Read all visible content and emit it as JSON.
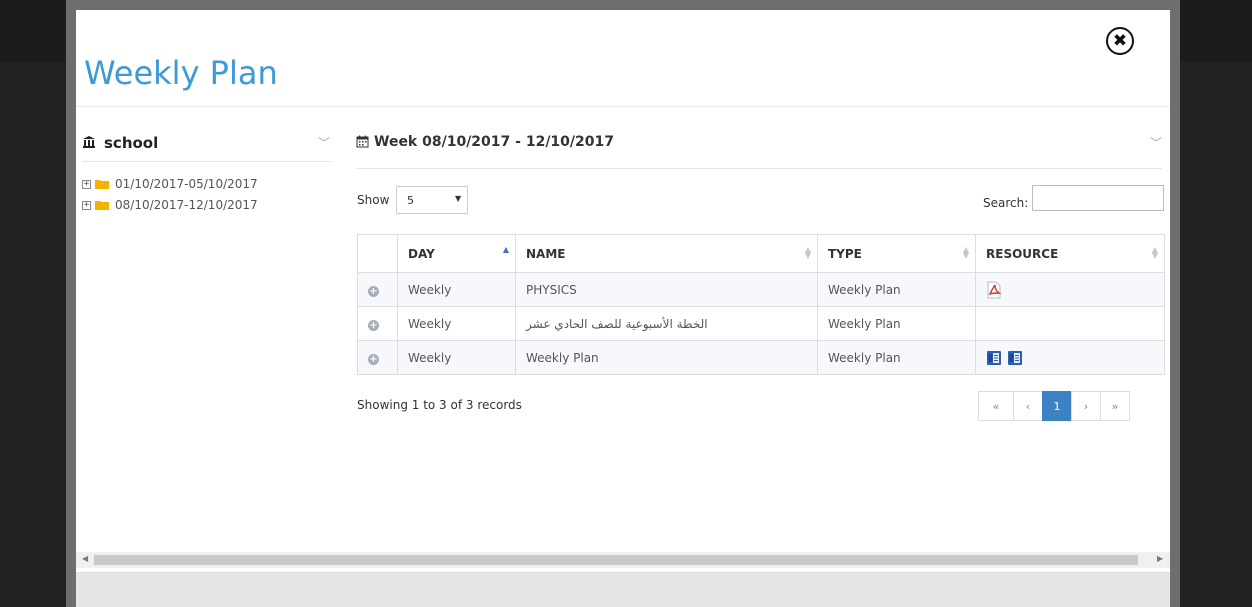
{
  "modal": {
    "title": "Weekly Plan",
    "close_symbol": "✖"
  },
  "tree": {
    "header_label": "school",
    "header_icon": "institution-icon",
    "nodes": [
      {
        "label": "01/10/2017-05/10/2017"
      },
      {
        "label": "08/10/2017-12/10/2017"
      }
    ]
  },
  "week": {
    "title": "Week 08/10/2017 - 12/10/2017",
    "icon": "calendar-icon"
  },
  "controls": {
    "show_label": "Show",
    "show_value": "5",
    "search_label": "Search:",
    "search_value": ""
  },
  "table": {
    "columns": [
      "DAY",
      "NAME",
      "TYPE",
      "RESOURCE"
    ],
    "sorted_column": "DAY",
    "rows": [
      {
        "day": "Weekly",
        "name": "PHYSICS",
        "type": "Weekly Plan",
        "resources": [
          "pdf-file-icon"
        ]
      },
      {
        "day": "Weekly",
        "name": "الخطة الأسبوعية للصف الحادي عشر",
        "type": "Weekly Plan",
        "resources": []
      },
      {
        "day": "Weekly",
        "name": "Weekly Plan",
        "type": "Weekly Plan",
        "resources": [
          "word-file-icon",
          "word-file-icon"
        ]
      }
    ]
  },
  "footer": {
    "showing_text": "Showing 1 to 3 of 3 records",
    "pager": {
      "first": "«",
      "prev": "‹",
      "current": "1",
      "next": "›",
      "last": "»"
    }
  },
  "colors": {
    "title": "#3c9ad7",
    "active_page": "#3a82c1",
    "folder": "#f0b400",
    "pdf": "#d9312b",
    "word": "#2b5fb5"
  }
}
